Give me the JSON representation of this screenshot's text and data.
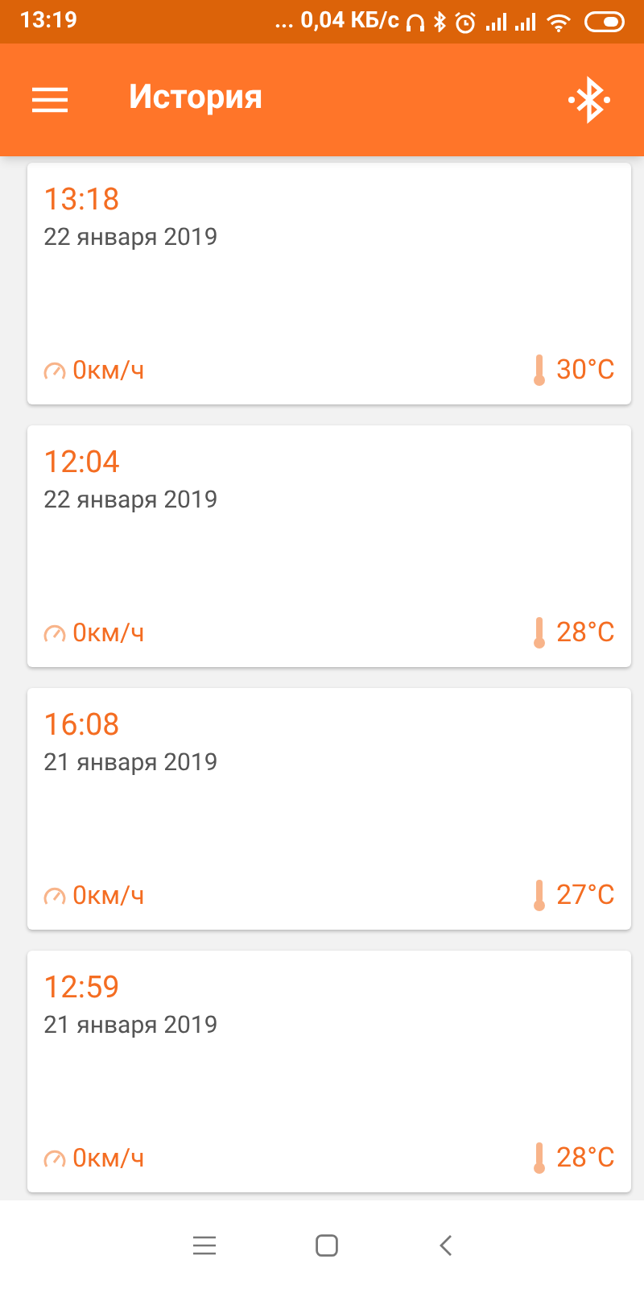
{
  "status_bar": {
    "time": "13:19",
    "dots": "...",
    "speed": "0,04 КБ/с"
  },
  "app_bar": {
    "title": "История"
  },
  "records": [
    {
      "time": "13:18",
      "date": "22 января 2019",
      "speed": "0км/ч",
      "temperature": "30°C"
    },
    {
      "time": "12:04",
      "date": "22 января 2019",
      "speed": "0км/ч",
      "temperature": "28°C"
    },
    {
      "time": "16:08",
      "date": "21 января 2019",
      "speed": "0км/ч",
      "temperature": "27°C"
    },
    {
      "time": "12:59",
      "date": "21 января 2019",
      "speed": "0км/ч",
      "temperature": "28°C"
    }
  ]
}
